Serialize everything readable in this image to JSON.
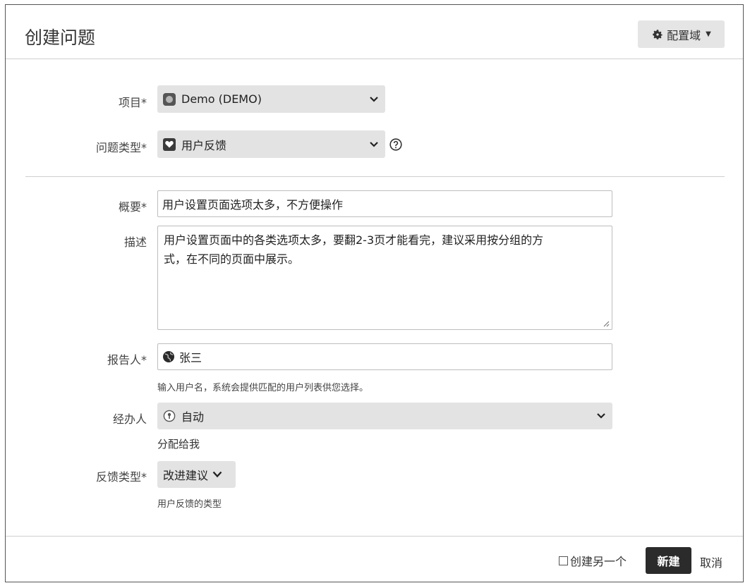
{
  "dialog": {
    "title": "创建问题",
    "config_button_label": "配置域"
  },
  "fields": {
    "project": {
      "label": "项目*",
      "value": "Demo (DEMO)"
    },
    "issue_type": {
      "label": "问题类型*",
      "value": "用户反馈"
    },
    "summary": {
      "label": "概要*",
      "value": "用户设置页面选项太多，不方便操作"
    },
    "description": {
      "label": "描述",
      "line1": "用户设置页面中的各类选项太多，要翻2-3页才能看完，建议采用按分组的方",
      "line2": "式，在不同的页面中展示。"
    },
    "reporter": {
      "label": "报告人*",
      "value": "张三",
      "hint": "输入用户名，系统会提供匹配的用户列表供您选择。"
    },
    "assignee": {
      "label": "经办人",
      "value": "自动",
      "assign_to_me": "分配给我"
    },
    "feedback_type": {
      "label": "反馈类型*",
      "value": "改进建议",
      "hint": "用户反馈的类型"
    }
  },
  "footer": {
    "create_another_label": "创建另一个",
    "create_button": "新建",
    "cancel_link": "取消"
  },
  "icons": {
    "config": "gear-icon",
    "project": "project-avatar-icon",
    "issue_type": "heart-icon",
    "help": "help-icon",
    "reporter": "globe-avatar-icon",
    "assignee": "auto-assign-icon"
  },
  "colors": {
    "field_background": "#e3e3e3",
    "primary_button": "#2b2b2b",
    "border": "#bdbdbd"
  }
}
